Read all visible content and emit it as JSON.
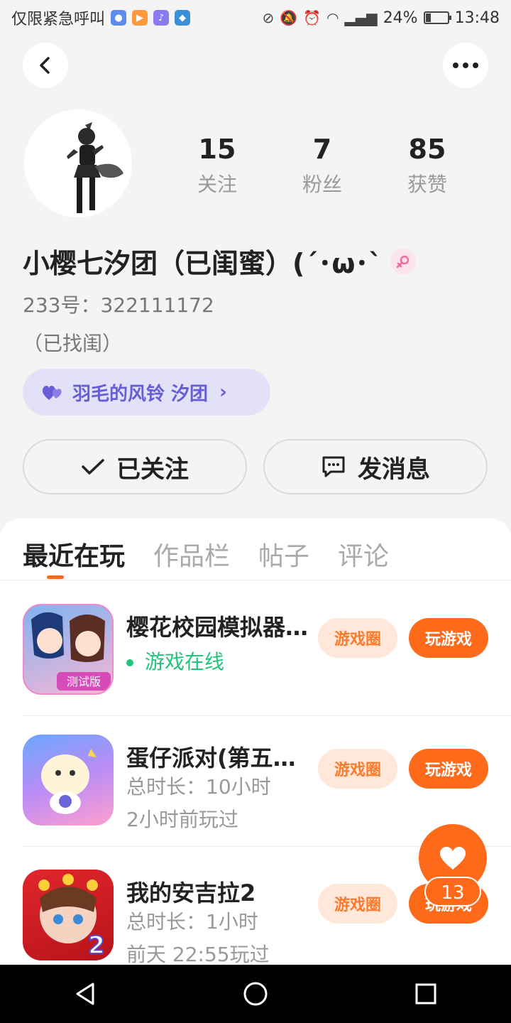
{
  "status_bar": {
    "carrier": "仅限紧急呼叫",
    "battery": "24%",
    "time": "13:48"
  },
  "profile": {
    "stats": [
      {
        "value": "15",
        "label": "关注"
      },
      {
        "value": "7",
        "label": "粉丝"
      },
      {
        "value": "85",
        "label": "获赞"
      }
    ],
    "username": "小樱七汐团（已闺蜜）(´･ω･`",
    "uid": "233号：322111172",
    "bio": "（已找闺）",
    "tag": "羽毛的风铃  汐团",
    "follow_button": "已关注",
    "message_button": "发消息"
  },
  "tabs": [
    {
      "label": "最近在玩"
    },
    {
      "label": "作品栏"
    },
    {
      "label": "帖子"
    },
    {
      "label": "评论"
    }
  ],
  "games": [
    {
      "title": "樱花校园模拟器测试版",
      "line1": "游戏在线",
      "line2": "",
      "circle_label": "游戏圈",
      "play_label": "玩游戏"
    },
    {
      "title": "蛋仔派对(第五人格联动)",
      "line1": "总时长：10小时",
      "line2": "2小时前玩过",
      "circle_label": "游戏圈",
      "play_label": "玩游戏"
    },
    {
      "title": "我的安吉拉2",
      "line1": "总时长：1小时",
      "line2": "前天 22:55玩过",
      "circle_label": "游戏圈",
      "play_label": "玩游戏"
    }
  ],
  "fab": {
    "count": "13"
  },
  "colors": {
    "accent": "#ff6a1a",
    "accent_light": "#ffe7d9",
    "tag_bg": "#e3e1f8",
    "tag_text": "#6a5cd6",
    "online": "#22c47a"
  }
}
